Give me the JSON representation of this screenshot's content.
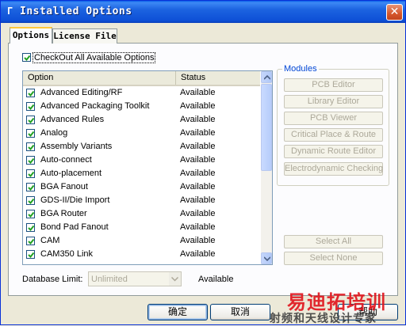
{
  "window": {
    "title": "Installed Options",
    "close_glyph": "✕"
  },
  "tabs": [
    {
      "label": "Options",
      "active": true
    },
    {
      "label": "License File",
      "active": false
    }
  ],
  "checkout_all": {
    "label": "CheckOut All Available Options",
    "checked": true
  },
  "list": {
    "columns": [
      "Option",
      "Status"
    ],
    "rows": [
      {
        "name": "Advanced Editing/RF",
        "status": "Available",
        "checked": true
      },
      {
        "name": "Advanced Packaging Toolkit",
        "status": "Available",
        "checked": true
      },
      {
        "name": "Advanced Rules",
        "status": "Available",
        "checked": true
      },
      {
        "name": "Analog",
        "status": "Available",
        "checked": true
      },
      {
        "name": "Assembly Variants",
        "status": "Available",
        "checked": true
      },
      {
        "name": "Auto-connect",
        "status": "Available",
        "checked": true
      },
      {
        "name": "Auto-placement",
        "status": "Available",
        "checked": true
      },
      {
        "name": "BGA Fanout",
        "status": "Available",
        "checked": true
      },
      {
        "name": "GDS-II/Die Import",
        "status": "Available",
        "checked": true
      },
      {
        "name": "BGA Router",
        "status": "Available",
        "checked": true
      },
      {
        "name": "Bond Pad Fanout",
        "status": "Available",
        "checked": true
      },
      {
        "name": "CAM",
        "status": "Available",
        "checked": true
      },
      {
        "name": "CAM350 Link",
        "status": "Available",
        "checked": true
      }
    ]
  },
  "modules": {
    "title": "Modules",
    "buttons": [
      "PCB Editor",
      "Library Editor",
      "PCB Viewer",
      "Critical Place & Route",
      "Dynamic Route Editor",
      "Electrodynamic Checking"
    ],
    "select_all": "Select All",
    "select_none": "Select None"
  },
  "database_limit": {
    "label": "Database Limit:",
    "value": "Unlimited",
    "status": "Available"
  },
  "dialog_buttons": {
    "ok": "确定",
    "cancel": "取消",
    "help": "帮助"
  },
  "watermark": {
    "line1": "易迪拓培训",
    "line2": "射频和天线设计专家"
  },
  "colors": {
    "accent": "#0046d5",
    "title_bar": "#0a5fe8",
    "checkmark": "#21a121"
  }
}
